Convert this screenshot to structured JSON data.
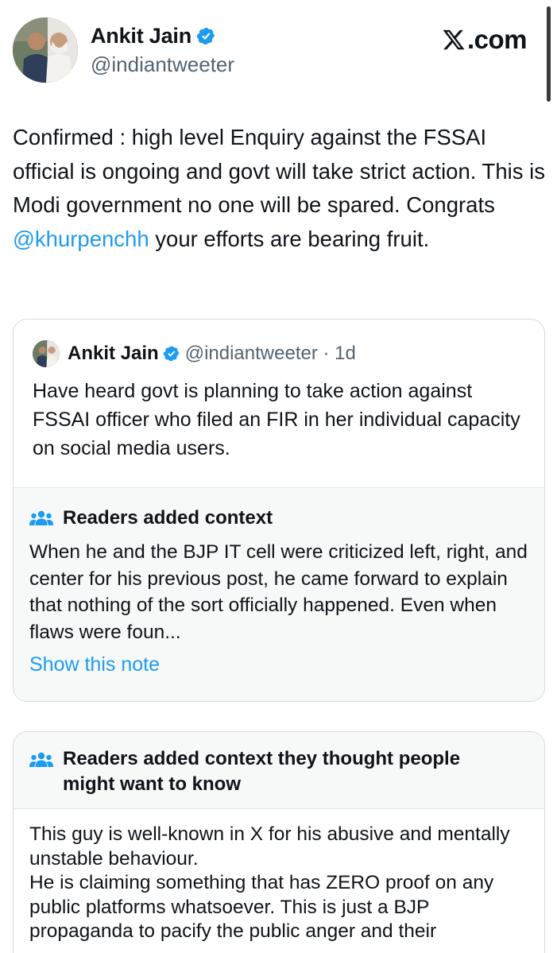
{
  "header": {
    "author_name": "Ankit Jain",
    "author_handle": "@indiantweeter",
    "brand": ".com",
    "brand_icon": "x-logo-icon",
    "verified_color": "#1d9bf0"
  },
  "tweet": {
    "text_before": "Confirmed : high level Enquiry against the FSSAI official is ongoing and govt will take strict action. This is Modi government no one will be spared. Congrats ",
    "mention": "@khurpenchh",
    "text_after": " your efforts are bearing fruit."
  },
  "quoted": {
    "author_name": "Ankit Jain",
    "handle_time": "@indiantweeter · 1d",
    "text": "Have heard govt is planning to take action against FSSAI officer who filed an FIR in her individual capacity on social media users.",
    "note": {
      "title": "Readers added context",
      "text": "When he and the BJP IT cell were criticized left, right, and center for his previous post, he came forward to explain that nothing of the sort officially happened. Even when flaws were foun...",
      "link": "Show this note"
    }
  },
  "context": {
    "title": "Readers added context they thought people might want to know",
    "text": "This guy is well-known in X for his abusive and mentally unstable behaviour.\n He is claiming something that has ZERO proof on any public platforms whatsoever. This is just a BJP propaganda to pacify the public anger and their"
  },
  "colors": {
    "link": "#1d9bf0",
    "muted": "#536471",
    "note_bg": "#f7f9f9"
  }
}
